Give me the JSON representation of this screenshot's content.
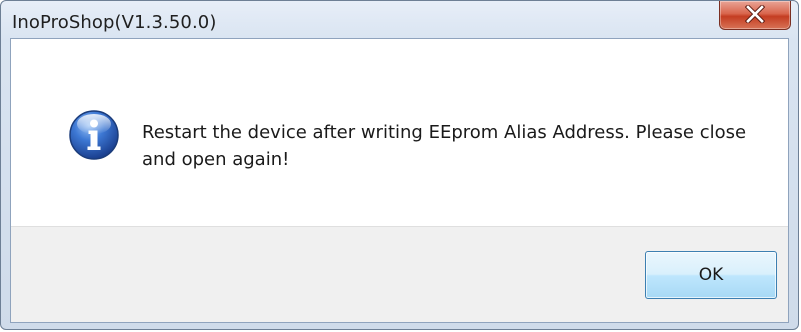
{
  "window": {
    "title": "InoProShop(V1.3.50.0)"
  },
  "message": {
    "text": "Restart the device after writing EEprom Alias Address. Please close and open again!",
    "icon": "info-icon"
  },
  "buttons": {
    "ok_label": "OK",
    "close_icon": "close-icon"
  },
  "colors": {
    "close_button": "#c9452a",
    "info_icon": "#2f67c4",
    "ok_button_border": "#3c7fb1",
    "button_area": "#f0f0f0"
  }
}
